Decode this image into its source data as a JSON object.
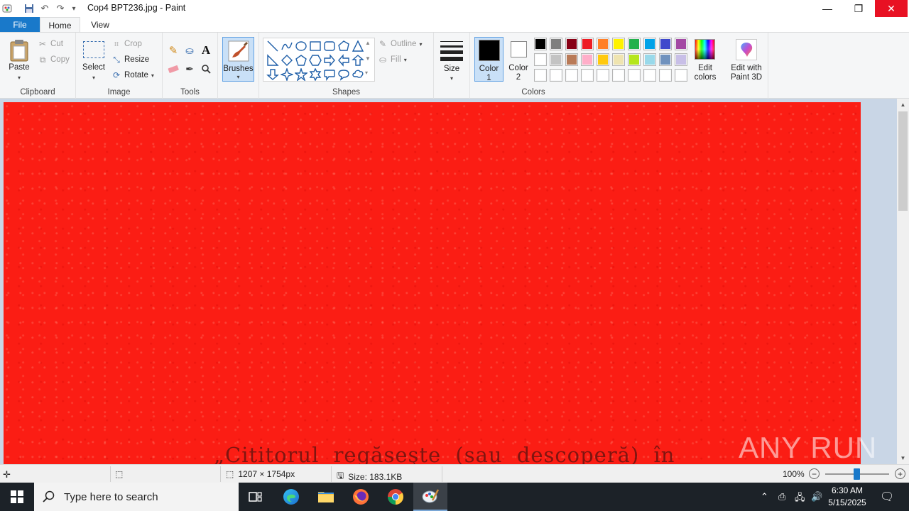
{
  "titlebar": {
    "title": "Cop4 BPT236.jpg - Paint",
    "icons": [
      "paint-app-icon",
      "save-icon",
      "undo-icon",
      "redo-icon",
      "customize-quick-access-icon"
    ],
    "controls": [
      "minimize",
      "maximize",
      "close"
    ]
  },
  "tabs": [
    {
      "label": "File",
      "active": false
    },
    {
      "label": "Home",
      "active": true
    },
    {
      "label": "View",
      "active": false
    }
  ],
  "ribbon": {
    "clipboard": {
      "label": "Clipboard",
      "paste": "Paste",
      "cut": "Cut",
      "copy": "Copy"
    },
    "image": {
      "label": "Image",
      "select": "Select",
      "crop": "Crop",
      "resize": "Resize",
      "rotate": "Rotate"
    },
    "tools": {
      "label": "Tools"
    },
    "brushes": {
      "label": "Brushes"
    },
    "shapes": {
      "label": "Shapes",
      "outline": "Outline",
      "fill": "Fill"
    },
    "size": {
      "label": "Size"
    },
    "colors": {
      "label": "Colors",
      "color1_label": "Color",
      "color1_num": "1",
      "color2_label": "Color",
      "color2_num": "2",
      "color1": "#000000",
      "color2": "#ffffff",
      "edit_colors": "Edit colors",
      "edit_with": "Edit with",
      "paint3d": "Paint 3D",
      "palette_row1": [
        "#000000",
        "#7f7f7f",
        "#880015",
        "#ed1c24",
        "#ff7f27",
        "#fff200",
        "#22b14c",
        "#00a2e8",
        "#3f48cc",
        "#a349a4"
      ],
      "palette_row2": [
        "#ffffff",
        "#c3c3c3",
        "#b97a57",
        "#ffaec9",
        "#ffc90e",
        "#efe4b0",
        "#b5e61d",
        "#99d9ea",
        "#7092be",
        "#c8bfe7"
      ],
      "palette_row3": [
        "#ffffff",
        "#ffffff",
        "#ffffff",
        "#ffffff",
        "#ffffff",
        "#ffffff",
        "#ffffff",
        "#ffffff",
        "#ffffff",
        "#ffffff"
      ]
    }
  },
  "canvas": {
    "image_color": "#fb1d14",
    "visible_text": "„Cititorul regăseşte (sau descoperă) în",
    "watermark": "ANY RUN"
  },
  "statusbar": {
    "dimensions": "1207 × 1754px",
    "size": "Size: 183.1KB",
    "zoom": "100%"
  },
  "taskbar": {
    "search_placeholder": "Type here to search",
    "time": "6:30 AM",
    "date": "5/15/2025"
  }
}
